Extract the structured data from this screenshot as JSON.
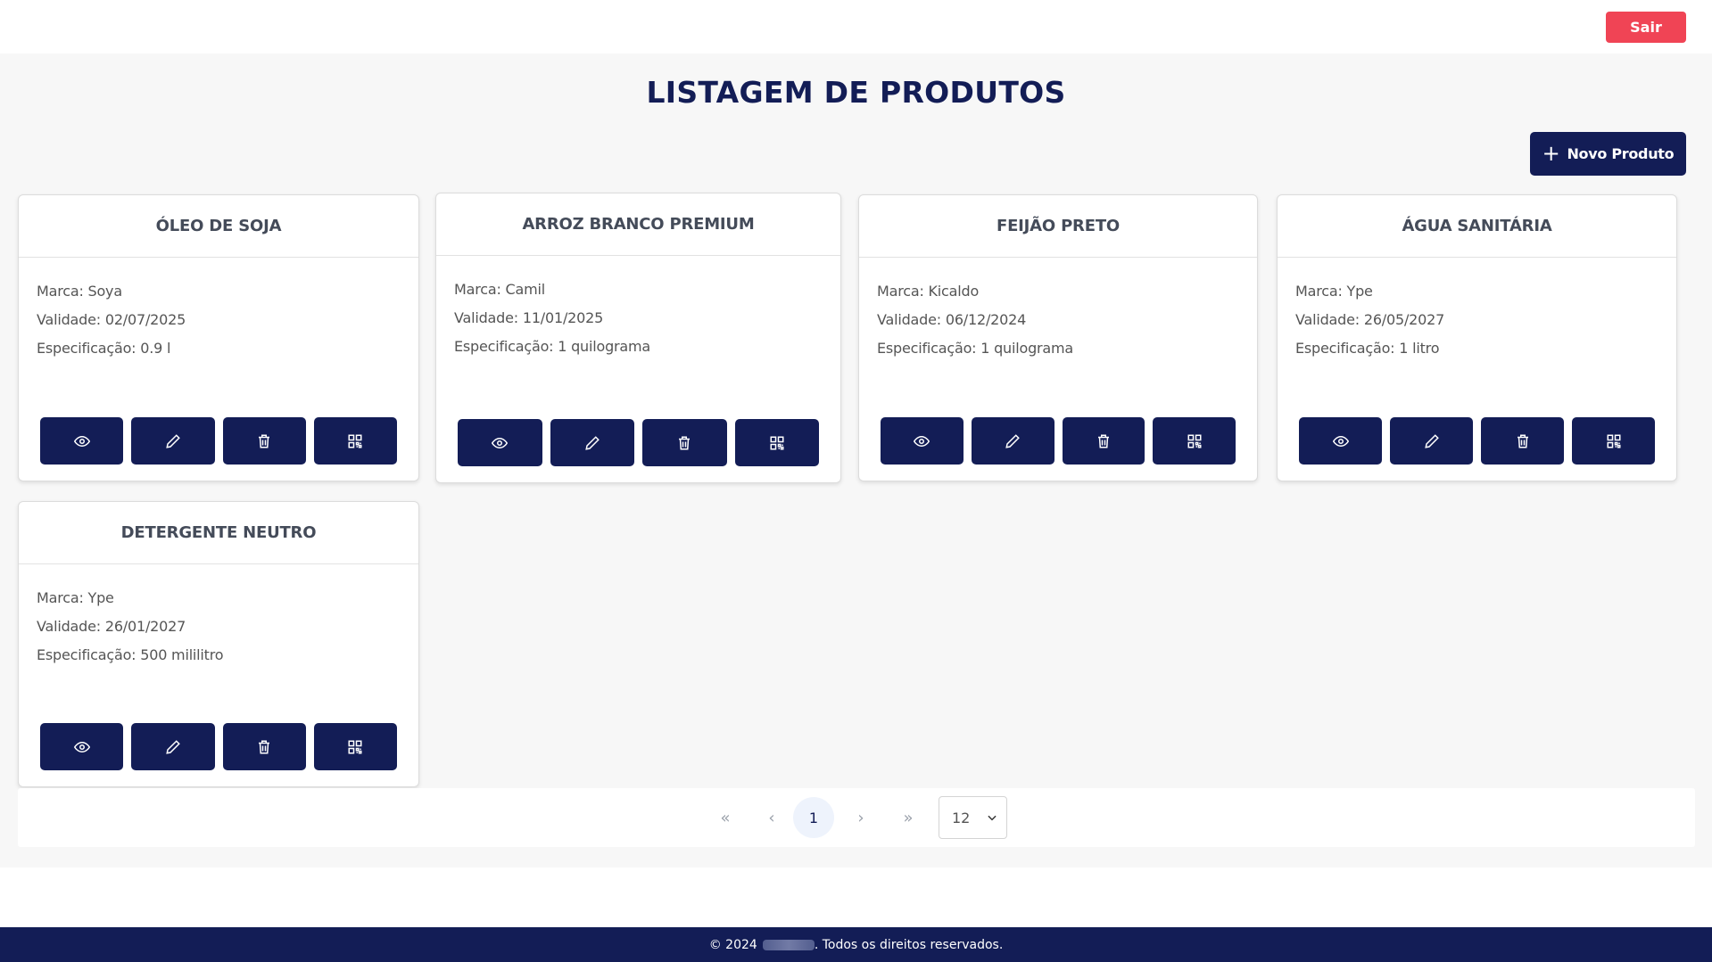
{
  "header": {
    "logout_label": "Sair"
  },
  "page": {
    "title": "LISTAGEM DE PRODUTOS",
    "new_button_label": "Novo Produto"
  },
  "products": [
    {
      "name": "ÓLEO DE SOJA",
      "brand": "Marca: Soya",
      "validity": "Validade: 02/07/2025",
      "spec": "Especificação: 0.9 l"
    },
    {
      "name": "ARROZ BRANCO PREMIUM",
      "brand": "Marca: Camil",
      "validity": "Validade: 11/01/2025",
      "spec": "Especificação: 1 quilograma"
    },
    {
      "name": "FEIJÃO PRETO",
      "brand": "Marca: Kicaldo",
      "validity": "Validade: 06/12/2024",
      "spec": "Especificação: 1 quilograma"
    },
    {
      "name": "ÁGUA SANITÁRIA",
      "brand": "Marca: Ype",
      "validity": "Validade: 26/05/2027",
      "spec": "Especificação: 1 litro"
    },
    {
      "name": "DETERGENTE NEUTRO",
      "brand": "Marca: Ype",
      "validity": "Validade: 26/01/2027",
      "spec": "Especificação: 500 mililitro"
    }
  ],
  "card_actions": [
    "eye-icon",
    "pencil-icon",
    "trash-icon",
    "qr-code-icon"
  ],
  "pagination": {
    "first": "«",
    "prev": "‹",
    "current": "1",
    "next": "›",
    "last": "»",
    "page_size": "12"
  },
  "footer": {
    "prefix": "© 2024",
    "suffix": ". Todos os direitos reservados."
  },
  "colors": {
    "primary": "#131d56",
    "danger": "#f04455",
    "background": "#f7f7f7"
  }
}
